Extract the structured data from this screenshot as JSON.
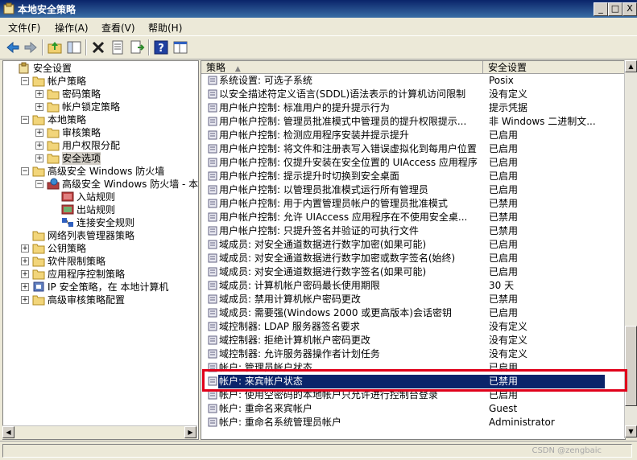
{
  "window": {
    "title": "本地安全策略",
    "controls": [
      "_",
      "□",
      "X"
    ]
  },
  "menu": [
    {
      "label": "文件(F)"
    },
    {
      "label": "操作(A)"
    },
    {
      "label": "查看(V)"
    },
    {
      "label": "帮助(H)"
    }
  ],
  "toolbar": {
    "icons": [
      "back-arrow-icon",
      "forward-arrow-icon",
      "up-folder-icon",
      "show-hide-tree-icon",
      "delete-icon",
      "properties-icon",
      "export-list-icon",
      "help-icon",
      "console-icon"
    ]
  },
  "tree": [
    {
      "label": "安全设置",
      "depth": 0,
      "exp": ""
    },
    {
      "label": "帐户策略",
      "depth": 1,
      "exp": "−"
    },
    {
      "label": "密码策略",
      "depth": 2,
      "exp": "+"
    },
    {
      "label": "帐户锁定策略",
      "depth": 2,
      "exp": "+"
    },
    {
      "label": "本地策略",
      "depth": 1,
      "exp": "−"
    },
    {
      "label": "审核策略",
      "depth": 2,
      "exp": "+"
    },
    {
      "label": "用户权限分配",
      "depth": 2,
      "exp": "+"
    },
    {
      "label": "安全选项",
      "depth": 2,
      "exp": "+",
      "selected": true
    },
    {
      "label": "高级安全 Windows 防火墙",
      "depth": 1,
      "exp": "−"
    },
    {
      "label": "高级安全 Windows 防火墙 - 本地",
      "depth": 2,
      "exp": "−"
    },
    {
      "label": "入站规则",
      "depth": 3,
      "exp": ""
    },
    {
      "label": "出站规则",
      "depth": 3,
      "exp": ""
    },
    {
      "label": "连接安全规则",
      "depth": 3,
      "exp": ""
    },
    {
      "label": "网络列表管理器策略",
      "depth": 1,
      "exp": ""
    },
    {
      "label": "公钥策略",
      "depth": 1,
      "exp": "+"
    },
    {
      "label": "软件限制策略",
      "depth": 1,
      "exp": "+"
    },
    {
      "label": "应用程序控制策略",
      "depth": 1,
      "exp": "+"
    },
    {
      "label": "IP 安全策略，在 本地计算机",
      "depth": 1,
      "exp": "+"
    },
    {
      "label": "高级审核策略配置",
      "depth": 1,
      "exp": "+"
    }
  ],
  "columns": {
    "policy": "策略",
    "setting": "安全设置"
  },
  "policies": [
    {
      "name": "系统设置: 可选子系统",
      "setting": "Posix"
    },
    {
      "name": "以安全描述符定义语言(SDDL)语法表示的计算机访问限制",
      "setting": "没有定义"
    },
    {
      "name": "用户帐户控制: 标准用户的提升提示行为",
      "setting": "提示凭据"
    },
    {
      "name": "用户帐户控制: 管理员批准模式中管理员的提升权限提示...",
      "setting": "非 Windows 二进制文..."
    },
    {
      "name": "用户帐户控制: 检测应用程序安装并提示提升",
      "setting": "已启用"
    },
    {
      "name": "用户帐户控制: 将文件和注册表写入错误虚拟化到每用户位置",
      "setting": "已启用"
    },
    {
      "name": "用户帐户控制: 仅提升安装在安全位置的 UIAccess 应用程序",
      "setting": "已启用"
    },
    {
      "name": "用户帐户控制: 提示提升时切换到安全桌面",
      "setting": "已启用"
    },
    {
      "name": "用户帐户控制: 以管理员批准模式运行所有管理员",
      "setting": "已启用"
    },
    {
      "name": "用户帐户控制: 用于内置管理员帐户的管理员批准模式",
      "setting": "已禁用"
    },
    {
      "name": "用户帐户控制: 允许 UIAccess 应用程序在不使用安全桌...",
      "setting": "已禁用"
    },
    {
      "name": "用户帐户控制: 只提升签名并验证的可执行文件",
      "setting": "已禁用"
    },
    {
      "name": "域成员: 对安全通道数据进行数字加密(如果可能)",
      "setting": "已启用"
    },
    {
      "name": "域成员: 对安全通道数据进行数字加密或数字签名(始终)",
      "setting": "已启用"
    },
    {
      "name": "域成员: 对安全通道数据进行数字签名(如果可能)",
      "setting": "已启用"
    },
    {
      "name": "域成员: 计算机帐户密码最长使用期限",
      "setting": "30 天"
    },
    {
      "name": "域成员: 禁用计算机帐户密码更改",
      "setting": "已禁用"
    },
    {
      "name": "域成员: 需要强(Windows 2000 或更高版本)会话密钥",
      "setting": "已启用"
    },
    {
      "name": "域控制器: LDAP 服务器签名要求",
      "setting": "没有定义"
    },
    {
      "name": "域控制器: 拒绝计算机帐户密码更改",
      "setting": "没有定义"
    },
    {
      "name": "域控制器: 允许服务器操作者计划任务",
      "setting": "没有定义"
    },
    {
      "name": "帐户: 管理员帐户状态",
      "setting": "已启用"
    },
    {
      "name": "帐户: 来宾帐户状态",
      "setting": "已禁用",
      "selected": true
    },
    {
      "name": "帐户: 使用空密码的本地帐户只允许进行控制台登录",
      "setting": "已启用"
    },
    {
      "name": "帐户: 重命名来宾帐户",
      "setting": "Guest"
    },
    {
      "name": "帐户: 重命名系统管理员帐户",
      "setting": "Administrator"
    }
  ],
  "watermark": "CSDN @zengbaic",
  "colors": {
    "title_bar": "#0a246a",
    "selection": "#0a246a",
    "highlight_box": "#e0001a"
  }
}
